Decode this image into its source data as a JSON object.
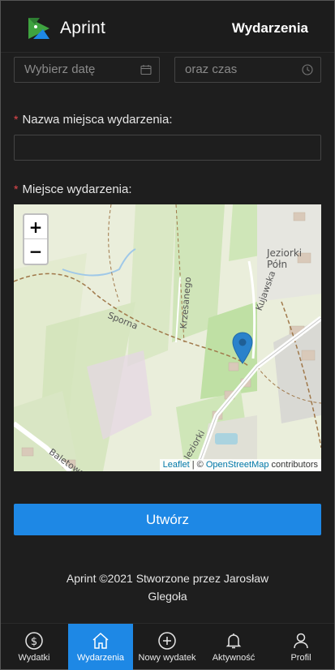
{
  "header": {
    "brand": "Aprint",
    "nav_link": "Wydarzenia",
    "logo_colors": {
      "green": "#3fa340",
      "blue": "#1e88e5"
    }
  },
  "form": {
    "date_placeholder": "Wybierz datę",
    "time_placeholder": "oraz czas",
    "name_label": "Nazwa miejsca wydarzenia:",
    "name_value": "",
    "location_label": "Miejsce wydarzenia:",
    "required_mark": "*"
  },
  "map": {
    "zoom_in": "+",
    "zoom_out": "−",
    "attribution": {
      "leaflet": "Leaflet",
      "separator": " | © ",
      "osm": "OpenStreetMap",
      "suffix": " contributors"
    },
    "place_labels": {
      "village": "Jeziorki Półn",
      "road_sporna": "Sporna",
      "road_krzesanego": "Krzesanego",
      "road_kujawska": "Kujawska",
      "road_jeziorki": "Jeziorki",
      "road_baletowa": "Baletowa"
    },
    "marker_color": "#2a82cb"
  },
  "submit_label": "Utwórz",
  "footer_text": "Aprint ©2021 Stworzone przez Jarosław Glegoła",
  "bottom_nav": [
    {
      "label": "Wydatki",
      "icon": "dollar-circle-icon",
      "active": false
    },
    {
      "label": "Wydarzenia",
      "icon": "home-icon",
      "active": true
    },
    {
      "label": "Nowy wydatek",
      "icon": "plus-circle-icon",
      "active": false
    },
    {
      "label": "Aktywność",
      "icon": "bell-icon",
      "active": false
    },
    {
      "label": "Profil",
      "icon": "user-icon",
      "active": false
    }
  ],
  "accent_color": "#1e88e5"
}
